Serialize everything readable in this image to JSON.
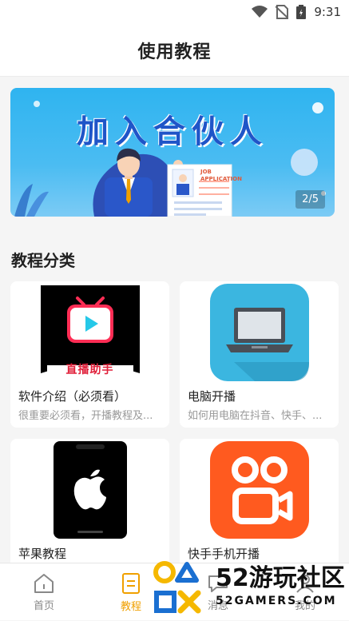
{
  "status_bar": {
    "time": "9:31"
  },
  "header": {
    "title": "使用教程"
  },
  "banner": {
    "title": "加入合伙人",
    "job_sign_line1": "JOB",
    "job_sign_line2": "APPLICATION",
    "indicator": "2/5"
  },
  "section": {
    "title": "教程分类"
  },
  "cards": [
    {
      "title": "软件介绍（必须看）",
      "desc": "很重要必须看，开播教程及...",
      "thumb_caption": "直播助手"
    },
    {
      "title": "电脑开播",
      "desc": "如何用电脑在抖音、快手、..."
    },
    {
      "title": "苹果教程",
      "desc": ""
    },
    {
      "title": "快手手机开播",
      "desc": ""
    }
  ],
  "tabbar": {
    "items": [
      {
        "label": "首页",
        "icon": "home-icon"
      },
      {
        "label": "教程",
        "icon": "tutorial-icon"
      },
      {
        "label": "消息",
        "icon": "message-icon"
      },
      {
        "label": "我的",
        "icon": "profile-icon"
      }
    ]
  },
  "watermark": {
    "line1": "52游玩社区",
    "line2": "52GAMERS.COM"
  },
  "colors": {
    "accent": "#f0a000",
    "banner_blue": "#2fb4f0",
    "kuaishou_orange": "#ff5a1f"
  }
}
